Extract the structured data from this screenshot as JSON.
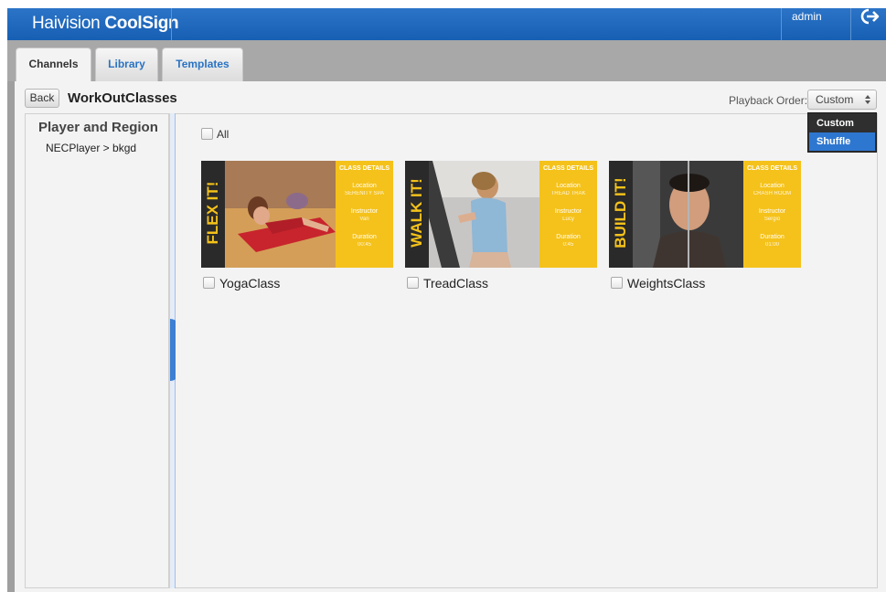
{
  "app": {
    "brand_light": "Hai",
    "brand_bold_i": "vision",
    "brand_product": " CoolSign",
    "user": "admin"
  },
  "tabs": [
    {
      "label": "Channels",
      "active": true
    },
    {
      "label": "Library",
      "active": false
    },
    {
      "label": "Templates",
      "active": false
    }
  ],
  "toolbar": {
    "back_label": "Back",
    "channel_name": "WorkOutClasses",
    "playback_order_label": "Playback Order:",
    "playback_order_value": "Custom",
    "playback_options": [
      "Custom",
      "Shuffle"
    ],
    "highlighted_option": "Shuffle"
  },
  "sidebar": {
    "title": "Player and Region",
    "item": "NECPlayer > bkgd"
  },
  "content": {
    "select_all_label": "All",
    "items": [
      {
        "name": "YogaClass",
        "banner": "FLEX IT!",
        "details_header": "CLASS DETAILS",
        "location_label": "Location",
        "location": "SERENITY SPA",
        "instructor_label": "Instructor",
        "instructor": "Vari",
        "duration_label": "Duration",
        "duration": "00:45"
      },
      {
        "name": "TreadClass",
        "banner": "WALK IT!",
        "details_header": "CLASS DETAILS",
        "location_label": "Location",
        "location": "TREAD TRAK",
        "instructor_label": "Instructor",
        "instructor": "Lucy",
        "duration_label": "Duration",
        "duration": "0:45"
      },
      {
        "name": "WeightsClass",
        "banner": "BUILD IT!",
        "details_header": "CLASS DETAILS",
        "location_label": "Location",
        "location": "CRASH ROOM",
        "instructor_label": "Instructor",
        "instructor": "Sergio",
        "duration_label": "Duration",
        "duration": "01:00"
      }
    ]
  },
  "colors": {
    "header_blue": "#1f68bd",
    "tab_link": "#2a73c3",
    "thumb_yellow": "#f5c21b",
    "menu_highlight": "#2e77d0"
  }
}
